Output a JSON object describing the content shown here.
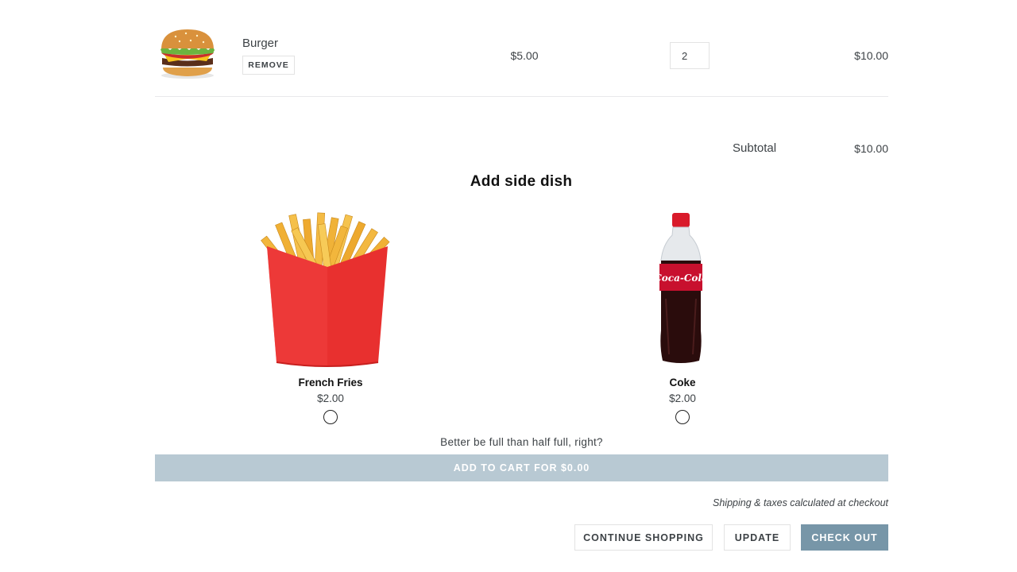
{
  "cart": {
    "item": {
      "name": "Burger",
      "remove_label": "REMOVE",
      "price": "$5.00",
      "quantity": "2",
      "total": "$10.00"
    },
    "subtotal_label": "Subtotal",
    "subtotal_value": "$10.00"
  },
  "side_dish": {
    "title": "Add side dish",
    "options": [
      {
        "name": "French Fries",
        "price": "$2.00"
      },
      {
        "name": "Coke",
        "price": "$2.00"
      }
    ],
    "tagline": "Better be full than half full, right?",
    "add_button_label": "ADD TO CART FOR $0.00"
  },
  "shipping_note": "Shipping & taxes calculated at checkout",
  "actions": {
    "continue_label": "CONTINUE SHOPPING",
    "update_label": "UPDATE",
    "checkout_label": "CHECK OUT"
  },
  "colors": {
    "add_button_bg": "#b8c9d3",
    "checkout_bg": "#7796a8",
    "fries_box": "#e8302f",
    "coke_label": "#c8102e"
  }
}
